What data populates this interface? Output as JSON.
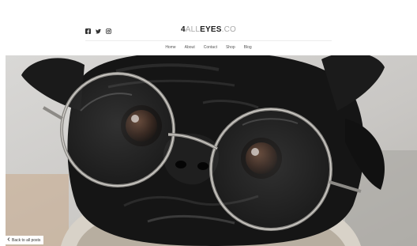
{
  "site": {
    "logo_part1": "4",
    "logo_part2": "ALL",
    "logo_part3": "EYES",
    "logo_part4": ".CO"
  },
  "social": [
    {
      "icon": "facebook-icon"
    },
    {
      "icon": "twitter-icon"
    },
    {
      "icon": "instagram-icon"
    }
  ],
  "nav": [
    "Home",
    "About",
    "Contact",
    "Shop",
    "Blog"
  ],
  "back_link": "Back to all posts",
  "hero_image": {
    "subject": "pug-with-round-glasses"
  }
}
